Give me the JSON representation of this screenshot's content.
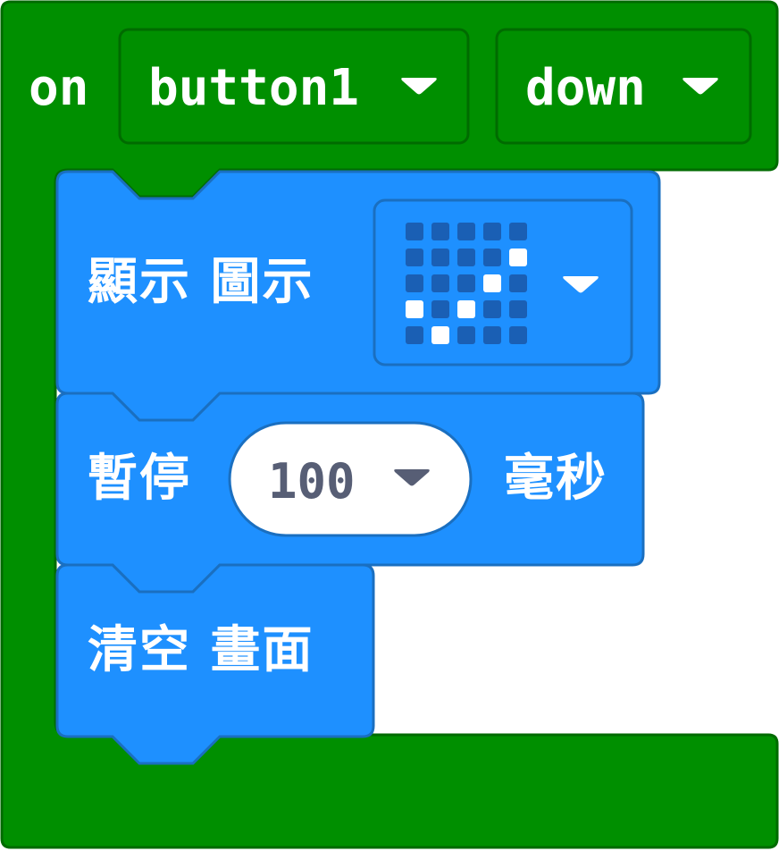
{
  "event_block": {
    "keyword": "on",
    "button_dropdown": {
      "value": "button1"
    },
    "action_dropdown": {
      "value": "down"
    },
    "color": "#008f00"
  },
  "show_icon_block": {
    "label": "顯示 圖示",
    "icon_picker": {
      "grid": [
        [
          0,
          0,
          0,
          0,
          0
        ],
        [
          0,
          0,
          0,
          0,
          1
        ],
        [
          0,
          0,
          0,
          1,
          0
        ],
        [
          1,
          0,
          1,
          0,
          0
        ],
        [
          0,
          1,
          0,
          0,
          0
        ]
      ]
    },
    "color": "#1e90ff"
  },
  "pause_block": {
    "label": "暫停",
    "ms_field": {
      "value": "100"
    },
    "unit": "毫秒",
    "color": "#1e90ff"
  },
  "clear_block": {
    "label": "清空 畫面",
    "color": "#1e90ff"
  }
}
